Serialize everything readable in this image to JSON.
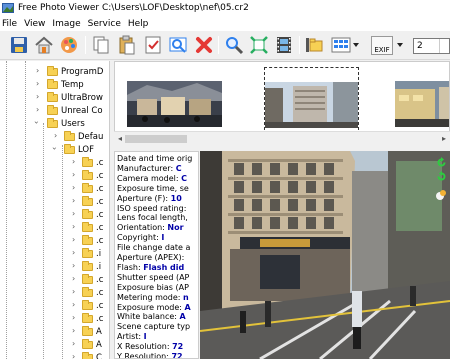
{
  "window": {
    "title": "Free Photo Viewer C:\\Users\\LOF\\Desktop\\nef\\05.cr2"
  },
  "menu": {
    "items": [
      "File",
      "View",
      "Image",
      "Service",
      "Help"
    ]
  },
  "toolbar": {
    "exif_label": "EXIF",
    "page_value": "2",
    "icons": [
      "save-icon",
      "home-icon",
      "palette-icon",
      "copy-icon",
      "paste-icon",
      "checklist-icon",
      "preview-icon",
      "delete-icon",
      "zoom-icon",
      "fit-icon",
      "filmstrip-icon",
      "folder-tree-icon",
      "grid-view-icon",
      "exif-icon"
    ]
  },
  "tree": {
    "top_items": [
      "ProgramD",
      "Temp",
      "UltraBrow",
      "Unreal Co",
      "Users"
    ],
    "users_children": [
      "Defau",
      "LOF"
    ],
    "lof_children": [
      ".c",
      ".c",
      ".c",
      ".c",
      ".c",
      ".c",
      ".c",
      ".i",
      ".i",
      ".c",
      ".c",
      ".c",
      ".c",
      "A",
      "A",
      "C"
    ]
  },
  "exif": {
    "rows": [
      {
        "label": "Date and time orig",
        "value": ""
      },
      {
        "label": "Manufacturer: ",
        "value": "C"
      },
      {
        "label": "Camera model: ",
        "value": "C"
      },
      {
        "label": "Exposure time, se",
        "value": ""
      },
      {
        "label": "Aperture (F): ",
        "value": "10"
      },
      {
        "label": "ISO speed rating:",
        "value": ""
      },
      {
        "label": "Lens focal length,",
        "value": ""
      },
      {
        "label": "Orientation: ",
        "value": "Nor"
      },
      {
        "label": "Copyright: ",
        "value": "I"
      },
      {
        "label": "File change date a",
        "value": ""
      },
      {
        "label": "Aperture (APEX):",
        "value": ""
      },
      {
        "label": "Flash: ",
        "value": "Flash did"
      },
      {
        "label": "Shutter speed (AP",
        "value": ""
      },
      {
        "label": "Exposure bias (AP",
        "value": ""
      },
      {
        "label": "Metering mode: ",
        "value": "n"
      },
      {
        "label": "Exposure mode: ",
        "value": "A"
      },
      {
        "label": "White balance: ",
        "value": "A"
      },
      {
        "label": "Scene capture typ",
        "value": ""
      },
      {
        "label": "Artist: ",
        "value": "I"
      },
      {
        "label": "X Resolution: ",
        "value": "72"
      },
      {
        "label": "Y Resolution: ",
        "value": "72"
      }
    ]
  },
  "colors": {
    "accent": "#0000a8",
    "folder": "#f7d154"
  }
}
